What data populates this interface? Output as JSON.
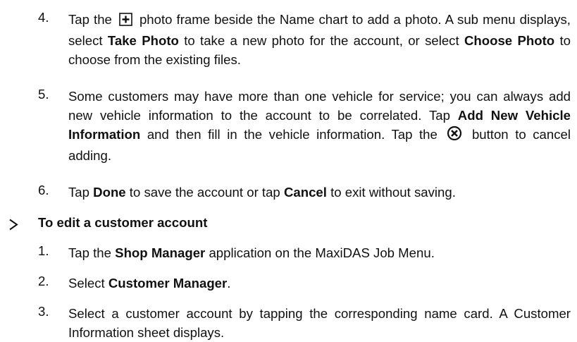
{
  "steps_continued": [
    {
      "number": "4.",
      "segments": [
        {
          "text": "Tap the ",
          "bold": false
        },
        {
          "icon": "plus-box-icon"
        },
        {
          "text": " photo frame beside the Name chart to add a photo. A sub menu displays, select ",
          "bold": false
        },
        {
          "text": "Take Photo",
          "bold": true
        },
        {
          "text": " to take a new photo for the account, or select ",
          "bold": false
        },
        {
          "text": "Choose Photo",
          "bold": true
        },
        {
          "text": " to choose from the existing files.",
          "bold": false
        }
      ]
    },
    {
      "number": "5.",
      "segments": [
        {
          "text": "Some customers may have more than one vehicle for service; you can always add new vehicle information to the account to be correlated. Tap ",
          "bold": false
        },
        {
          "text": "Add New Vehicle Information",
          "bold": true
        },
        {
          "text": " and then fill in the vehicle information. Tap the ",
          "bold": false
        },
        {
          "icon": "circle-x-icon"
        },
        {
          "text": " button to cancel adding.",
          "bold": false
        }
      ]
    },
    {
      "number": "6.",
      "segments": [
        {
          "text": "Tap ",
          "bold": false
        },
        {
          "text": "Done",
          "bold": true
        },
        {
          "text": " to save the account or tap ",
          "bold": false
        },
        {
          "text": "Cancel",
          "bold": true
        },
        {
          "text": " to exit without saving.",
          "bold": false
        }
      ]
    }
  ],
  "section": {
    "bullet_icon": "arrow-bullet-icon",
    "heading": "To edit a customer account"
  },
  "steps_edit": [
    {
      "number": "1.",
      "segments": [
        {
          "text": "Tap the ",
          "bold": false
        },
        {
          "text": "Shop Manager",
          "bold": true
        },
        {
          "text": " application on the MaxiDAS Job Menu.",
          "bold": false
        }
      ]
    },
    {
      "number": "2.",
      "segments": [
        {
          "text": "Select ",
          "bold": false
        },
        {
          "text": "Customer Manager",
          "bold": true
        },
        {
          "text": ".",
          "bold": false
        }
      ]
    },
    {
      "number": "3.",
      "segments": [
        {
          "text": "Select a customer account by tapping the corresponding name card. A Customer Information sheet displays.",
          "bold": false
        }
      ]
    }
  ]
}
